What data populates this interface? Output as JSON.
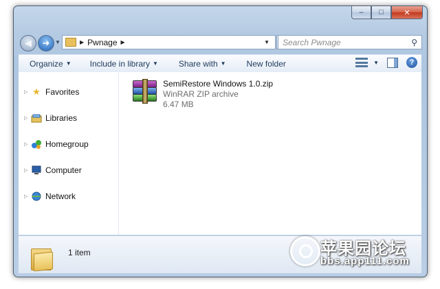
{
  "window": {
    "caption_buttons": {
      "minimize": "–",
      "maximize": "□",
      "close": "✕"
    }
  },
  "address_bar": {
    "crumbs": [
      "Pwnage"
    ],
    "search_placeholder": "Search Pwnage"
  },
  "toolbar": {
    "organize": "Organize",
    "include_in_library": "Include in library",
    "share_with": "Share with",
    "new_folder": "New folder"
  },
  "nav_pane": {
    "items": [
      {
        "label": "Favorites",
        "icon": "star-icon"
      },
      {
        "label": "Libraries",
        "icon": "libraries-icon"
      },
      {
        "label": "Homegroup",
        "icon": "homegroup-icon"
      },
      {
        "label": "Computer",
        "icon": "computer-icon"
      },
      {
        "label": "Network",
        "icon": "network-icon"
      }
    ]
  },
  "files": [
    {
      "name": "SemiRestore Windows 1.0.zip",
      "type": "WinRAR ZIP archive",
      "size": "6.47 MB",
      "icon": "winrar-archive-icon"
    }
  ],
  "details_pane": {
    "item_count": "1 item"
  },
  "watermark": {
    "site_name": "苹果园论坛",
    "url": "bbs.app111.com"
  },
  "colors": {
    "frame": "#b5cbe3",
    "toolbar_text": "#1e395b",
    "meta_text": "#6d6d6d"
  }
}
